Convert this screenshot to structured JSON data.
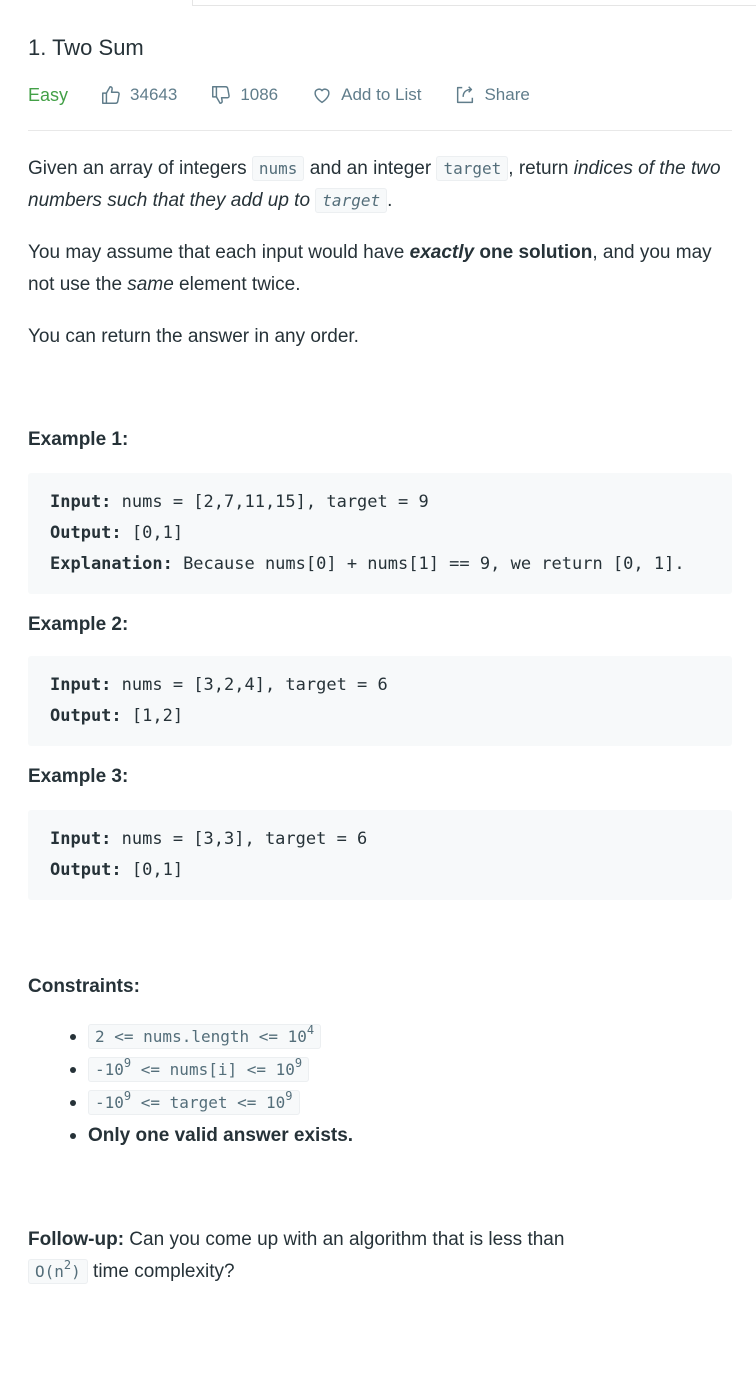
{
  "problem": {
    "title": "1. Two Sum",
    "difficulty": "Easy",
    "likes": "34643",
    "dislikes": "1086",
    "add_to_list": "Add to List",
    "share": "Share"
  },
  "description": {
    "p1": {
      "t1": "Given an array of integers ",
      "code1": "nums",
      "t2": " and an integer ",
      "code2": "target",
      "t3": ", return ",
      "em": "indices of the two numbers such that they add up to",
      "t4": " ",
      "code3": "target",
      "t5": "."
    },
    "p2": {
      "t1": "You may assume that each input would have ",
      "em_bold": "exactly",
      "bold": " one solution",
      "t2": ", and you may not use the ",
      "em": "same",
      "t3": " element twice."
    },
    "p3": "You can return the answer in any order."
  },
  "examples": [
    {
      "title": "Example 1:",
      "input_label": "Input:",
      "input": " nums = [2,7,11,15], target = 9",
      "output_label": "Output:",
      "output": " [0,1]",
      "explanation_label": "Explanation:",
      "explanation": " Because nums[0] + nums[1] == 9, we return [0, 1]."
    },
    {
      "title": "Example 2:",
      "input_label": "Input:",
      "input": " nums = [3,2,4], target = 6",
      "output_label": "Output:",
      "output": " [1,2]"
    },
    {
      "title": "Example 3:",
      "input_label": "Input:",
      "input": " nums = [3,3], target = 6",
      "output_label": "Output:",
      "output": " [0,1]"
    }
  ],
  "constraints": {
    "title": "Constraints:",
    "c1": {
      "base": "2 <= nums.length <= 10",
      "sup": "4"
    },
    "c2": {
      "a": "-10",
      "sup1": "9",
      "b": " <= nums[i] <= 10",
      "sup2": "9"
    },
    "c3": {
      "a": "-10",
      "sup1": "9",
      "b": " <= target <= 10",
      "sup2": "9"
    },
    "c4": "Only one valid answer exists."
  },
  "followup": {
    "label": "Follow-up:",
    "t1": " Can you come up with an algorithm that is less than ",
    "code_a": "O(n",
    "code_sup": "2",
    "code_b": ")",
    "t2": " time complexity?"
  },
  "colors": {
    "easy": "#43a047",
    "meta": "#607d8b",
    "code_bg": "#f7f9fa"
  },
  "icons": [
    "thumbs-up-icon",
    "thumbs-down-icon",
    "heart-icon",
    "share-icon"
  ]
}
